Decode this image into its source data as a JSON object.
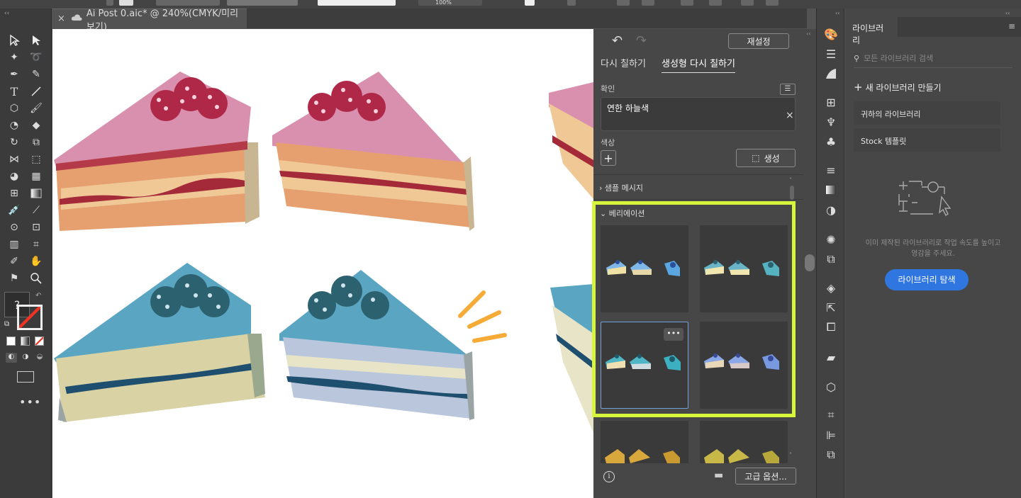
{
  "document": {
    "tab_title": "Ai Post 0.aic* @ 240%(CMYK/미리 보기)",
    "zoom_partial": "100%"
  },
  "recolor": {
    "reset_label": "재설정",
    "tab_recolor": "다시 칠하기",
    "tab_generative": "생성형 다시 칠하기",
    "prompt_section": "확인",
    "prompt_value": "연한 하늘색",
    "color_section": "색상",
    "generate_label": "생성",
    "sample_prompts": "샘플 메시지",
    "variations": "베리에이션",
    "advanced_label": "고급 옵션...",
    "highlight_color": "#d7f53c"
  },
  "libraries": {
    "tab_label": "라이브러리",
    "search_placeholder": "모든 라이브러리 검색",
    "create_new": "새 라이브러리 만들기",
    "items": [
      "귀하의 라이브러리",
      "Stock 템플릿"
    ],
    "empty_text": "이미 제작된 라이브러리로 작업 속도를 높이고 영감을 주세요.",
    "explore_label": "라이브러리 탐색",
    "accent": "#2f76e0"
  },
  "canvas": {
    "colors": {
      "pink_top": "#d98fae",
      "cake_body": "#e6a070",
      "cake_layer": "#f0c896",
      "jam": "#a42a3a",
      "berry": "#b02848",
      "blue_top": "#5aa6c2",
      "blue_body": "#d9d2a4",
      "blue_stripe": "#1f4f6e",
      "berry_blue": "#2c6170",
      "accent_lines": "#f5ab35"
    }
  }
}
